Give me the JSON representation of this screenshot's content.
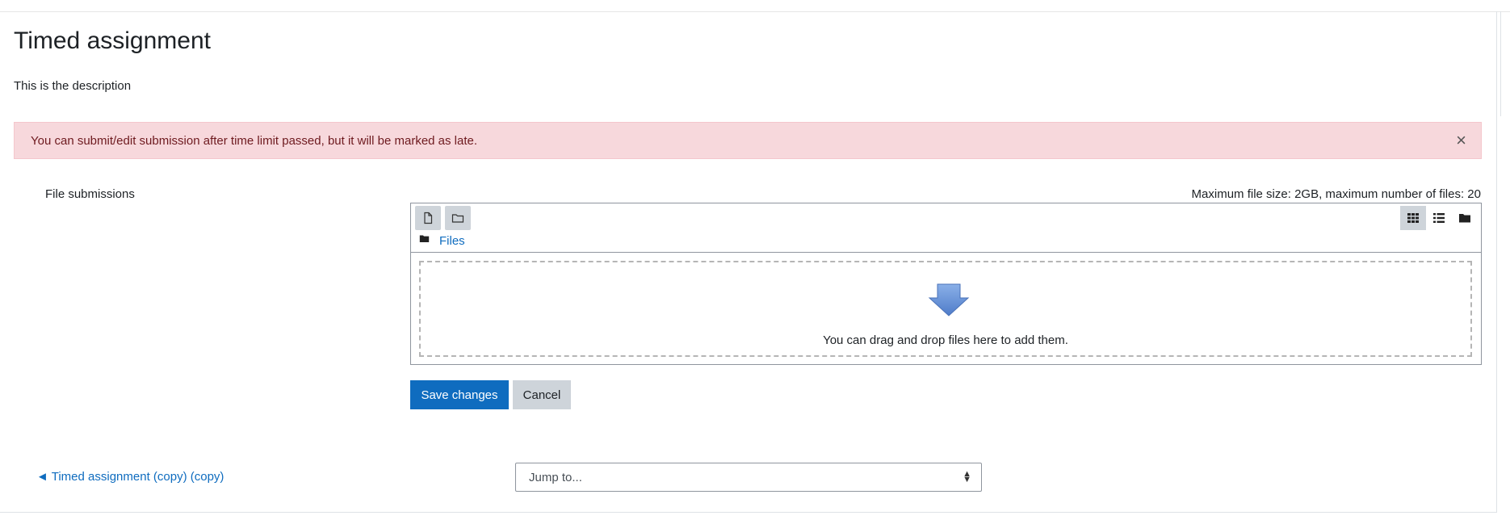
{
  "page": {
    "title": "Timed assignment",
    "description": "This is the description"
  },
  "alert": {
    "message": "You can submit/edit submission after time limit passed, but it will be marked as late.",
    "close_glyph": "×",
    "colors": {
      "background": "#f7d8dc",
      "text": "#6e1a1f"
    }
  },
  "submission": {
    "label": "File submissions",
    "limits_text": "Maximum file size: 2GB, maximum number of files: 20",
    "filepicker": {
      "toolbar_icons": [
        "add-file-icon",
        "create-folder-icon"
      ],
      "view_icons": [
        "grid-view-icon",
        "list-view-icon",
        "tree-view-icon"
      ],
      "active_view": "grid-view-icon",
      "path_label": "Files",
      "dropzone_text": "You can drag and drop files here to add them."
    }
  },
  "actions": {
    "save_label": "Save changes",
    "cancel_label": "Cancel",
    "colors": {
      "primary": "#0f6cbf",
      "secondary": "#ced4da"
    }
  },
  "navigation": {
    "previous_link": "◄ Timed assignment (copy) (copy)",
    "jump_placeholder": "Jump to..."
  }
}
